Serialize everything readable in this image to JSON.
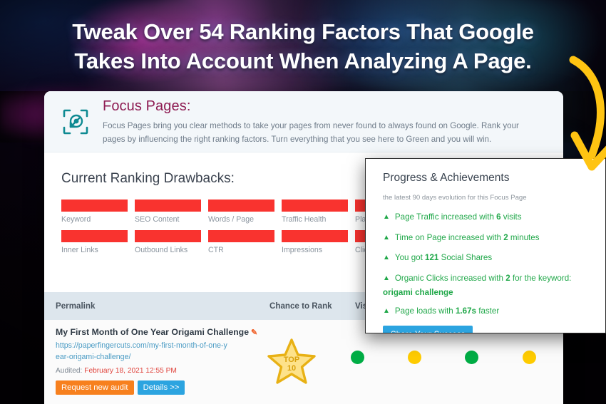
{
  "headline": {
    "line1": "Tweak Over 54 Ranking Factors That Google",
    "line2": "Takes Into Account When Analyzing A Page."
  },
  "card": {
    "header": {
      "icon": "focus-target-icon",
      "title": "Focus Pages:",
      "description": "Focus Pages bring you clear methods to take your pages from never found to always found on Google. Rank your pages by influencing the right ranking factors. Turn everything that you see here to Green and you will win."
    },
    "drawbacks": {
      "title": "Current Ranking Drawbacks:",
      "row1": [
        "Keyword",
        "SEO Content",
        "Words / Page",
        "Traffic Health",
        "Platform Health"
      ],
      "row2": [
        "Inner Links",
        "Outbound Links",
        "CTR",
        "Impressions",
        "Clicks"
      ],
      "bar_color": "#f9332f"
    },
    "table": {
      "headers": {
        "permalink": "Permalink",
        "chance": "Chance to Rank",
        "visibility": "Visibili"
      },
      "row": {
        "title": "My First Month of One Year Origami Challenge",
        "edit_icon": "edit-pencil-icon",
        "url": "https://paperfingercuts.com/my-first-month-of-one-year-origami-challenge/",
        "audited_label": "Audited:",
        "audited_date": "February 18, 2021 12:55 PM",
        "btn_request": "Request new audit",
        "btn_details": "Details >>",
        "badge_top": "TOP",
        "badge_rank": "10",
        "status_dots": [
          "#00ad45",
          "#ffcc00",
          "#00ad45",
          "#ffcc00"
        ]
      }
    }
  },
  "panel": {
    "title": "Progress & Achievements",
    "subtitle": "the latest 90 days evolution for this Focus Page",
    "achievements": [
      {
        "pre": "Page Traffic increased with ",
        "value": "6",
        "post": " visits"
      },
      {
        "pre": "Time on Page increased with ",
        "value": "2",
        "post": " minutes"
      },
      {
        "pre": "You got ",
        "value": "121",
        "post": " Social Shares"
      },
      {
        "pre": "Organic Clicks increased with ",
        "value": "2",
        "post": " for the keyword:"
      }
    ],
    "keyword": "origami challenge",
    "last_achievement": {
      "pre": "Page loads with ",
      "value": "1.67s",
      "post": " faster"
    },
    "share_button": "Share Your Success",
    "arrow_color": "#ffc412"
  }
}
